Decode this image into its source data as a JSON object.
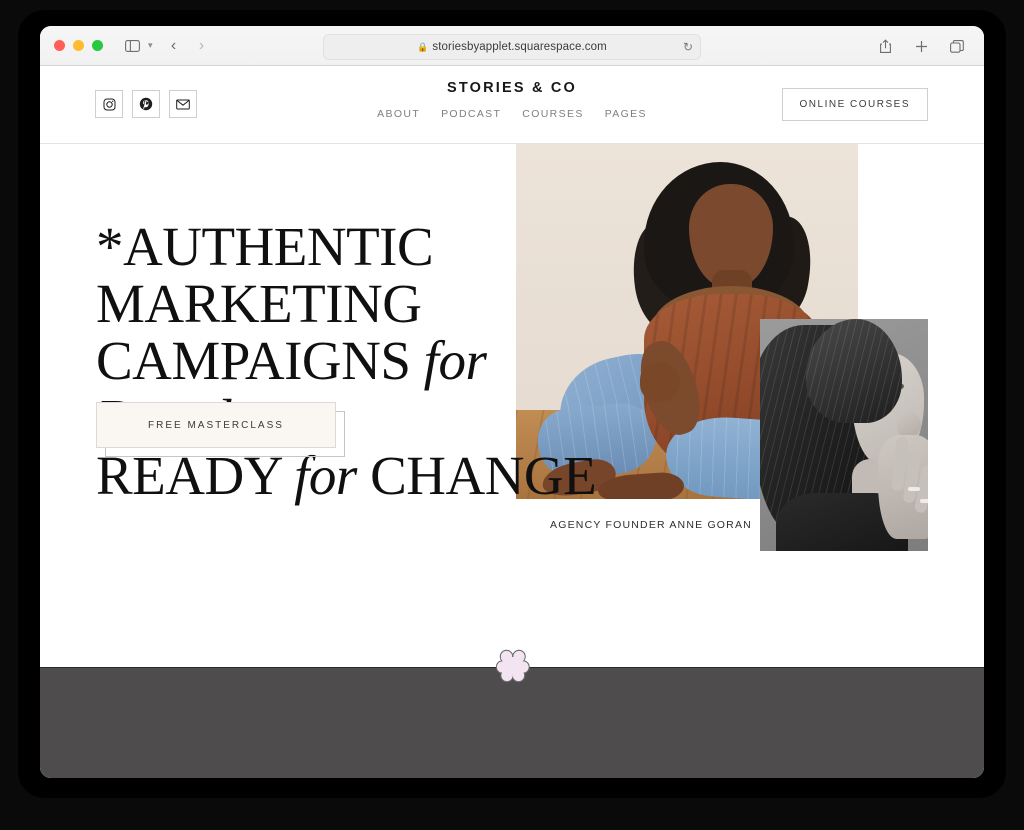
{
  "browser": {
    "traffic_lights": [
      "close",
      "minimize",
      "zoom"
    ],
    "sidebar_toggle_icon": "sidebar-icon",
    "sidebar_dropdown_icon": "chevron-down-icon",
    "back_icon": "chevron-left-icon",
    "forward_icon": "chevron-right-icon",
    "address": {
      "lock_icon": "lock-icon",
      "url": "storiesbyapplet.squarespace.com",
      "reload_icon": "reload-icon"
    },
    "actions": {
      "share_icon": "share-icon",
      "new_tab_icon": "plus-icon",
      "tab_overview_icon": "tab-overview-icon"
    }
  },
  "site": {
    "header": {
      "brand": "STORIES & CO",
      "social": [
        {
          "name": "instagram",
          "label": "Instagram"
        },
        {
          "name": "pinterest",
          "label": "Pinterest"
        },
        {
          "name": "email",
          "label": "Email"
        }
      ],
      "nav": [
        {
          "label": "ABOUT"
        },
        {
          "label": "PODCAST"
        },
        {
          "label": "COURSES"
        },
        {
          "label": "PAGES"
        }
      ],
      "cta": "ONLINE COURSES"
    },
    "hero": {
      "headline": {
        "line1_pre": "*AUTHENTIC MARKETING",
        "line2_pre": "CAMPAIGNS ",
        "line2_italic": "for Brands",
        "line3_pre": "READY ",
        "line3_italic": "for",
        "line3_post": " CHANGE"
      },
      "button": "FREE MASTERCLASS",
      "caption": "AGENCY FOUNDER ANNE GORAN",
      "images": [
        {
          "name": "hero-photo-main",
          "alt": "Woman in rust off-shoulder top and light blue jeans sitting on a wood floor against a cream wall"
        },
        {
          "name": "hero-photo-secondary",
          "alt": "Black and white profile portrait of a woman with long hair resting her hand near her face"
        }
      ]
    },
    "cursor": {
      "name": "flower-cursor",
      "color": "#f2e2f0"
    }
  },
  "colors": {
    "page_background": "#ffffff",
    "footer_strip": "#4e4c4c",
    "bezel": "#0a0a0a",
    "toolbar": "#f4f4f4",
    "cta_fill": "#faf6f2",
    "nav_text": "#7d7f82",
    "headline_text": "#101010"
  }
}
